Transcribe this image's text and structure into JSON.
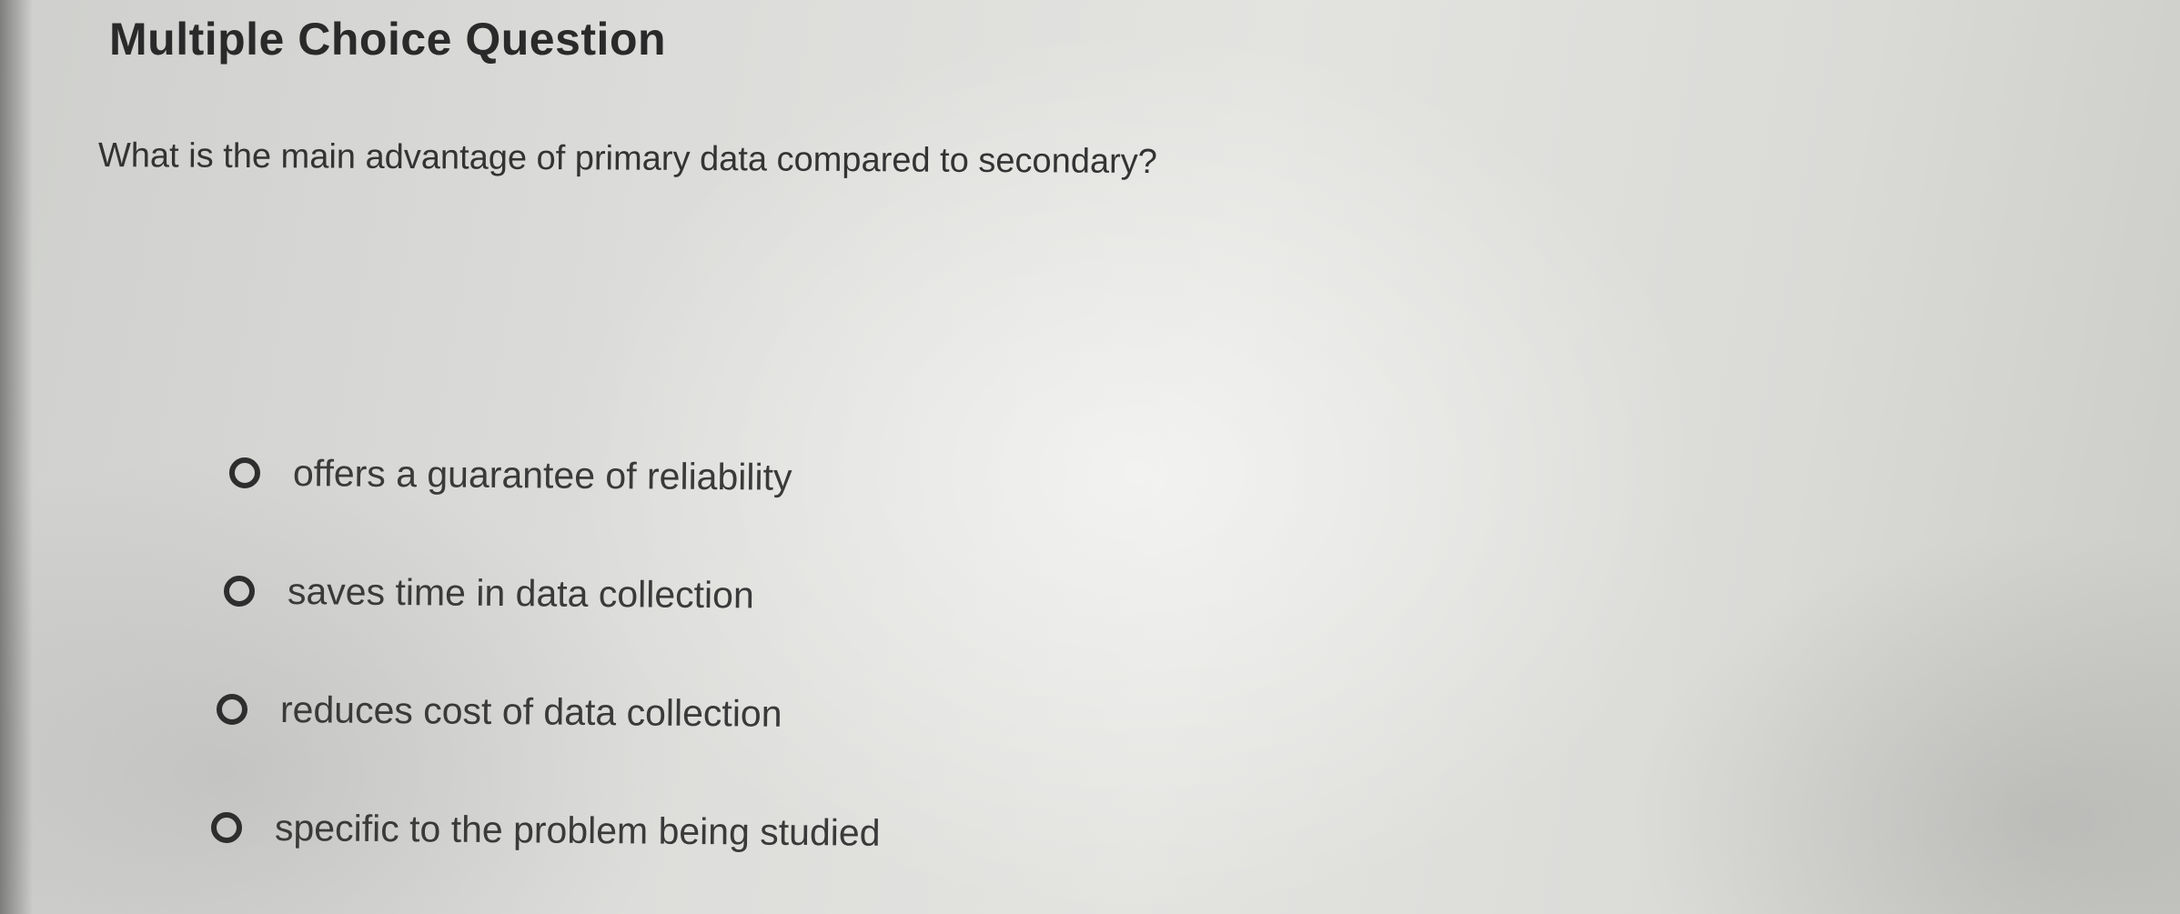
{
  "question": {
    "type_label": "Multiple Choice Question",
    "prompt": "What is the main advantage of primary data compared to secondary?",
    "options": [
      {
        "label": "offers a guarantee of reliability",
        "selected": false
      },
      {
        "label": "saves time in data collection",
        "selected": false
      },
      {
        "label": "reduces cost of data collection",
        "selected": false
      },
      {
        "label": "specific to the problem being studied",
        "selected": false
      }
    ]
  }
}
